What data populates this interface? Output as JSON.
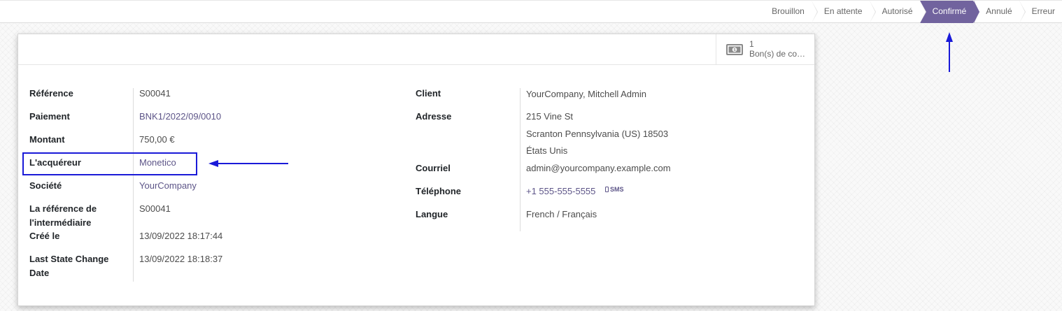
{
  "statusbar": {
    "steps": [
      "Brouillon",
      "En attente",
      "Autorisé",
      "Confirmé",
      "Annulé",
      "Erreur"
    ],
    "active": "Confirmé"
  },
  "smart_button": {
    "value": "1",
    "label": "Bon(s) de co…",
    "icon": "money-icon"
  },
  "fields_left": {
    "reference": {
      "label": "Référence",
      "value": "S00041"
    },
    "paiement": {
      "label": "Paiement",
      "value": "BNK1/2022/09/0010"
    },
    "montant": {
      "label": "Montant",
      "value": "750,00 €"
    },
    "acquereur": {
      "label": "L'acquéreur",
      "value": "Monetico"
    },
    "societe": {
      "label": "Société",
      "value": "YourCompany"
    },
    "ref_intermediaire": {
      "label_line1": "La référence de",
      "label_line2": "l'intermédiaire",
      "value": "S00041"
    },
    "cree_le": {
      "label": "Créé le",
      "value": "13/09/2022 18:17:44"
    },
    "last_state": {
      "label_line1": "Last State Change",
      "label_line2": "Date",
      "value": "13/09/2022 18:18:37"
    }
  },
  "fields_right": {
    "client": {
      "label": "Client",
      "value": "YourCompany, Mitchell Admin"
    },
    "adresse": {
      "label": "Adresse",
      "line1": "215 Vine St",
      "line2": "Scranton  Pennsylvania (US)  18503",
      "line3": "États Unis"
    },
    "courriel": {
      "label": "Courriel",
      "value": "admin@yourcompany.example.com"
    },
    "telephone": {
      "label": "Téléphone",
      "value": "+1 555-555-5555",
      "sms": "SMS"
    },
    "langue": {
      "label": "Langue",
      "value": "French / Français"
    }
  },
  "colors": {
    "accent": "#71639e",
    "link": "#5d5588",
    "annotation": "#1a1ad8"
  }
}
